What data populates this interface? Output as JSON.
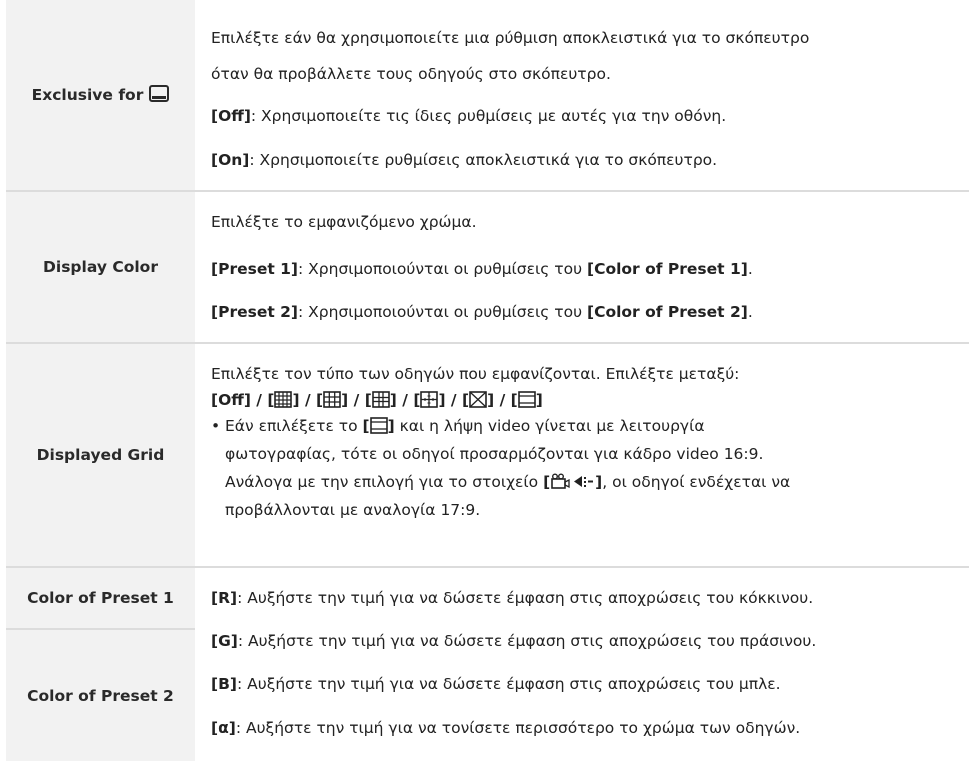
{
  "rows": {
    "exclusive": {
      "label": "Exclusive for",
      "icon": "viewfinder-monitor-icon",
      "line1": "Επιλέξτε εάν θα χρησιμοποιείτε μια ρύθμιση αποκλειστικά για το σκόπευτρο",
      "line2": "όταν θα προβάλλετε τους οδηγούς στο σκόπευτρο.",
      "off_key": "[Off]",
      "off_text": ": Χρησιμοποιείτε τις ίδιες ρυθμίσεις με αυτές για την οθόνη.",
      "on_key": "[On]",
      "on_text": ": Χρησιμοποιείτε ρυθμίσεις αποκλειστικά για το σκόπευτρο."
    },
    "display_color": {
      "label": "Display Color",
      "line1": "Επιλέξτε το εμφανιζόμενο χρώμα.",
      "p1_key": "[Preset 1]",
      "p1_text": ": Χρησιμοποιούνται οι ρυθμίσεις του ",
      "p1_ref": "[Color of Preset 1]",
      "p2_key": "[Preset 2]",
      "p2_text": ": Χρησιμοποιούνται οι ρυθμίσεις του ",
      "p2_ref": "[Color of Preset 2]",
      "period": "."
    },
    "displayed_grid": {
      "label": "Displayed Grid",
      "line1": "Επιλέξτε τον τύπο των οδηγών που εμφανίζονται. Επιλέξτε μεταξύ:",
      "off_key": "[Off]",
      "sep": " / ",
      "bullet": "•",
      "b1a": "Εάν επιλέξετε το ",
      "b1b": " και η λήψη video γίνεται με λειτουργία",
      "b2": "φωτογραφίας, τότε οι οδηγοί προσαρμόζονται για κάδρο video 16:9.",
      "b3a": "Ανάλογα με την επιλογή για το στοιχείο ",
      "b3b": ", οι οδηγοί ενδέχεται να",
      "b4": "προβάλλονται με αναλογία 17:9."
    },
    "presets": {
      "label1": "Color of Preset 1",
      "label2": "Color of Preset 2",
      "r_key": "[R]",
      "r_text": ": Αυξήστε την τιμή για να δώσετε έμφαση στις αποχρώσεις του κόκκινου.",
      "g_key": "[G]",
      "g_text": ": Αυξήστε την τιμή για να δώσετε έμφαση στις αποχρώσεις του πράσινου.",
      "b_key": "[B]",
      "b_text": ": Αυξήστε την τιμή για να δώσετε έμφαση στις αποχρώσεις του μπλε.",
      "a_key": "[α]",
      "a_text": ": Αυξήστε την τιμή για να τονίσετε περισσότερο το χρώμα των οδηγών."
    }
  }
}
